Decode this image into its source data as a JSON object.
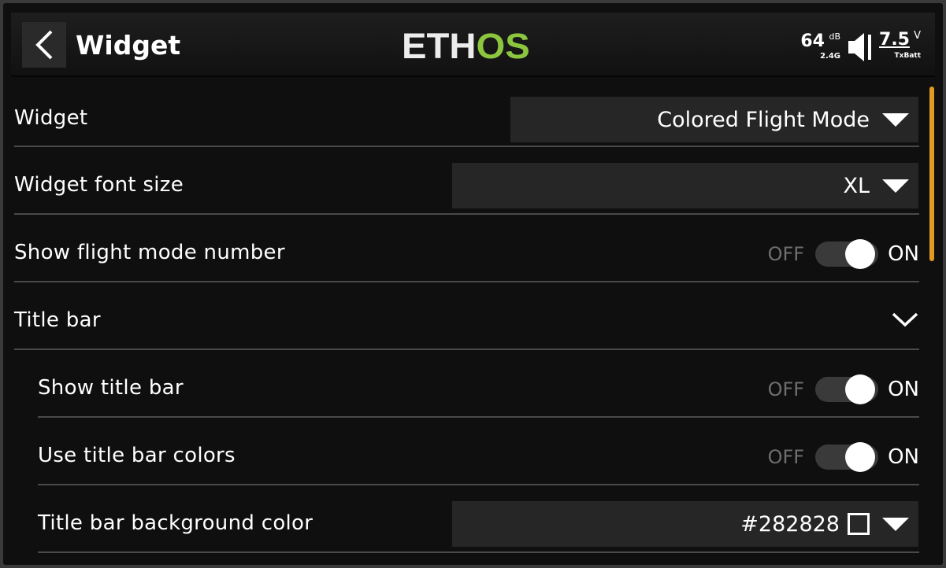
{
  "header": {
    "title": "Widget",
    "logo_left": "ETH",
    "logo_right": "OS",
    "rssi": "64",
    "rssi_unit": "dB",
    "band": "2.4G",
    "voltage": "7.5",
    "voltage_unit": "V",
    "battery_label": "TxBatt"
  },
  "rows": {
    "widget": {
      "label": "Widget",
      "value": "Colored Flight Mode"
    },
    "font_size": {
      "label": "Widget font size",
      "value": "XL"
    },
    "show_fm_number": {
      "label": "Show flight mode number",
      "off": "OFF",
      "on": "ON"
    },
    "title_bar": {
      "label": "Title bar"
    },
    "show_title_bar": {
      "label": "Show title bar",
      "off": "OFF",
      "on": "ON"
    },
    "use_title_colors": {
      "label": "Use title bar colors",
      "off": "OFF",
      "on": "ON"
    },
    "title_bg_color": {
      "label": "Title bar background color",
      "value": "#282828"
    }
  },
  "colors": {
    "accent": "#8cc63f",
    "scroll_indicator": "#e09a1f",
    "title_bar_bg_swatch": "#282828"
  }
}
